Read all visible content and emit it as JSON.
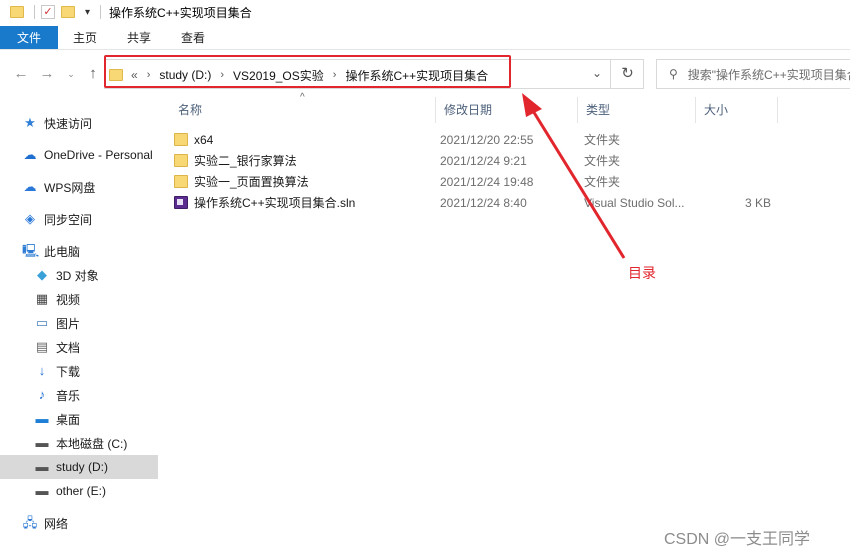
{
  "window": {
    "title": "操作系统C++实现项目集合"
  },
  "ribbon": {
    "tabs": [
      "文件",
      "主页",
      "共享",
      "查看"
    ]
  },
  "address": {
    "overflow": "«",
    "crumbs": [
      "study (D:)",
      "VS2019_OS实验",
      "操作系统C++实现项目集合"
    ]
  },
  "search": {
    "placeholder": "搜索\"操作系统C++实现项目集合\""
  },
  "sidebar": {
    "items": [
      {
        "label": "快速访问",
        "icon": "star-icon"
      },
      {
        "label": "OneDrive - Personal",
        "icon": "cloud-icon"
      },
      {
        "label": "WPS网盘",
        "icon": "wps-cloud-icon"
      },
      {
        "label": "同步空间",
        "icon": "sync-icon"
      },
      {
        "label": "此电脑",
        "icon": "computer-icon"
      },
      {
        "label": "3D 对象",
        "icon": "cube-icon"
      },
      {
        "label": "视频",
        "icon": "video-icon"
      },
      {
        "label": "图片",
        "icon": "picture-icon"
      },
      {
        "label": "文档",
        "icon": "document-icon"
      },
      {
        "label": "下载",
        "icon": "download-icon"
      },
      {
        "label": "音乐",
        "icon": "music-icon"
      },
      {
        "label": "桌面",
        "icon": "desktop-icon"
      },
      {
        "label": "本地磁盘 (C:)",
        "icon": "drive-icon"
      },
      {
        "label": "study (D:)",
        "icon": "drive-icon",
        "selected": true
      },
      {
        "label": "other (E:)",
        "icon": "drive-icon"
      },
      {
        "label": "网络",
        "icon": "network-icon"
      }
    ]
  },
  "columns": {
    "name": "名称",
    "date": "修改日期",
    "type": "类型",
    "size": "大小"
  },
  "files": [
    {
      "name": "x64",
      "date": "2021/12/20 22:55",
      "type": "文件夹",
      "size": "",
      "icon": "folder-icon"
    },
    {
      "name": "实验二_银行家算法",
      "date": "2021/12/24 9:21",
      "type": "文件夹",
      "size": "",
      "icon": "folder-icon"
    },
    {
      "name": "实验一_页面置换算法",
      "date": "2021/12/24 19:48",
      "type": "文件夹",
      "size": "",
      "icon": "folder-icon"
    },
    {
      "name": "操作系统C++实现项目集合.sln",
      "date": "2021/12/24 8:40",
      "type": "Visual Studio Sol...",
      "size": "3 KB",
      "icon": "visual-studio-solution-icon"
    }
  ],
  "annotation": {
    "label": "目录",
    "color": "#e1262d"
  },
  "watermark": "CSDN @一支王同学",
  "colors": {
    "accent": "#1979ca",
    "folder": "#f8d775",
    "selected": "#d9d9d9"
  }
}
